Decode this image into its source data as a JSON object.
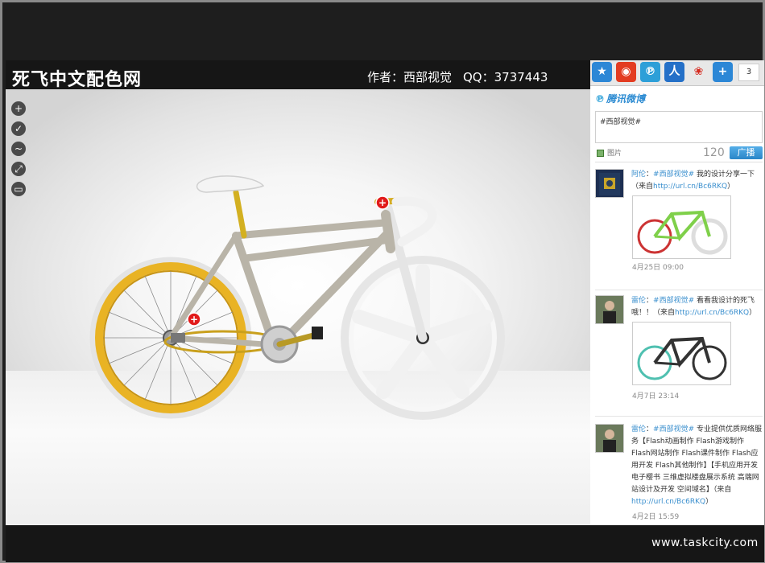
{
  "header": {
    "title": "死飞中文配色网",
    "author": "作者：西部视觉",
    "qq": "QQ：3737443"
  },
  "toolbar": {
    "icons": [
      "zoom-in-icon",
      "check-icon",
      "wave-icon",
      "fullscreen-icon",
      "print-icon"
    ]
  },
  "bike": {
    "frame_color": "#b9b4a8",
    "rim_front_color": "#e9b324",
    "wheel_rear_color": "#f3f3f3",
    "marker_symbol": "+"
  },
  "share": {
    "icons": [
      "star-icon",
      "weibo-icon",
      "tencent-icon",
      "renren-icon",
      "sohu-icon",
      "plus-icon"
    ],
    "count": "3"
  },
  "weibo": {
    "brand": "腾讯微博",
    "post_text": "#西部视觉#",
    "image_label": "图片",
    "char_count": "120",
    "publish": "广播"
  },
  "feed": [
    {
      "user": "阿伦",
      "colon": "：",
      "tag": "#西部视觉#",
      "text": " 我的设计分享一下（来自",
      "url": "http://url.cn/Bc6RKQ",
      "tail": "）",
      "time": "4月25日 09:00"
    },
    {
      "user": "雷伦",
      "colon": "：",
      "tag": "#西部视觉#",
      "text": " 看看我设计的死飞哦！！（来自",
      "url": "http://url.cn/Bc6RKQ",
      "tail": "）",
      "time": "4月7日 23:14"
    },
    {
      "user": "雷伦",
      "colon": "：",
      "tag": "#西部视觉#",
      "text": " 专业提供优质网络服务【Flash动画制作 Flash游戏制作 Flash网站制作 Flash课件制作 Flash应用开发 Flash其他制作】【手机应用开发 电子樱书 三维虚拟楼盘展示系统 高端网站设计及开发 空间域名】（来自",
      "url": "http://url.cn/Bc6RKQ",
      "tail": "）",
      "time": "4月2日 15:59"
    }
  ],
  "footer": {
    "url": "www.taskcity.com"
  }
}
